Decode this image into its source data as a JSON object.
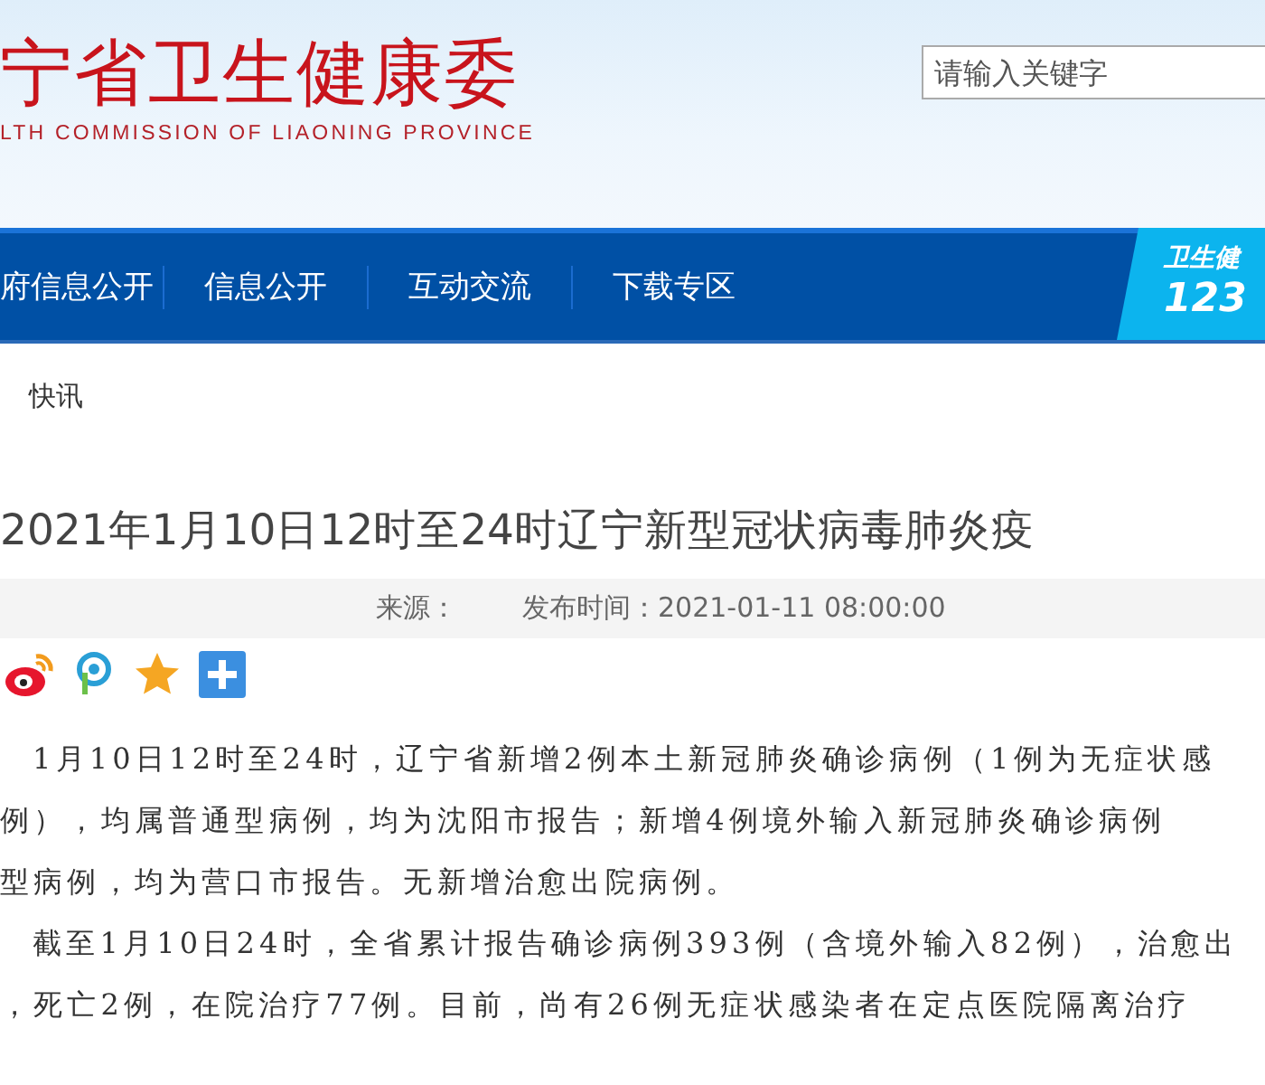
{
  "header": {
    "logo_title": "宁省卫生健康委",
    "logo_subtitle": "LTH COMMISSION OF LIAONING PROVINCE",
    "search": {
      "placeholder": "请输入关键字"
    }
  },
  "nav": {
    "items": [
      {
        "label": "府信息公开"
      },
      {
        "label": "信息公开"
      },
      {
        "label": "互动交流"
      },
      {
        "label": "下载专区"
      }
    ],
    "hotline": {
      "label": "卫生健",
      "number": "123"
    }
  },
  "breadcrumb": "快讯",
  "article": {
    "title": "2021年1月10日12时至24时辽宁新型冠状病毒肺炎疫",
    "source_label": "来源：",
    "publish_time": "发布时间：2021-01-11 08:00:00",
    "paragraphs": [
      {
        "lines": [
          "1月10日12时至24时，辽宁省新增2例本土新冠肺炎确诊病例（1例为无症状感",
          "例），均属普通型病例，均为沈阳市报告；新增4例境外输入新冠肺炎确诊病例",
          "型病例，均为营口市报告。无新增治愈出院病例。"
        ]
      },
      {
        "lines": [
          "截至1月10日24时，全省累计报告确诊病例393例（含境外输入82例），治愈出",
          "，死亡2例，在院治疗77例。目前，尚有26例无症状感染者在定点医院隔离治疗"
        ]
      }
    ]
  }
}
